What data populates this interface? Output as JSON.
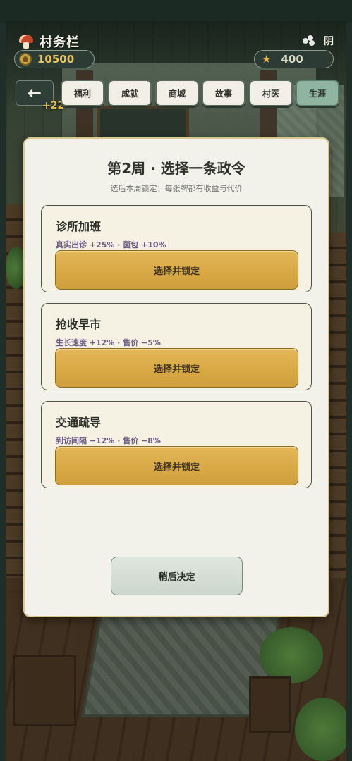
{
  "hud": {
    "title": "村务栏",
    "coins": "10500",
    "stars": "400",
    "weather": "阴",
    "bonus": "+22",
    "title_icon": "mushroom-icon",
    "coin_icon": "coin-icon",
    "star_icon": "star-icon",
    "weather_icon": "wind-icon"
  },
  "nav": {
    "back_label": "←",
    "tabs": [
      {
        "label": "福利"
      },
      {
        "label": "成就"
      },
      {
        "label": "商城"
      },
      {
        "label": "故事"
      },
      {
        "label": "村医"
      },
      {
        "label": "生涯",
        "active": true
      }
    ]
  },
  "modal": {
    "title": "第2周 · 选择一条政令",
    "subtitle": "选后本周锁定；每张牌都有收益与代价",
    "cards": [
      {
        "name": "诊所加班",
        "effect": "真实出诊 +25% · 菌包 +10%",
        "button": "选择并锁定"
      },
      {
        "name": "抢收早市",
        "effect": "生长速度 +12% · 售价 −5%",
        "button": "选择并锁定"
      },
      {
        "name": "交通疏导",
        "effect": "到访间隔 −12% · 售价 −8%",
        "button": "选择并锁定"
      }
    ],
    "later_button": "稍后决定"
  },
  "colors": {
    "accent_gold": "#d8a845",
    "active_tab": "#8fb5a1",
    "coin_text": "#e9c25b",
    "effect_text": "#6e5d86"
  }
}
